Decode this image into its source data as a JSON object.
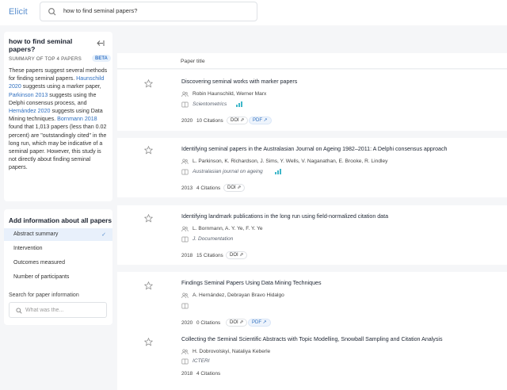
{
  "app": {
    "logo": "Elicit"
  },
  "search": {
    "query": "how to find seminal papers?"
  },
  "summary": {
    "question": "how to find seminal papers?",
    "label": "SUMMARY OF TOP 4 PAPERS",
    "badge": "BETA",
    "t1": "These papers suggest several methods for finding seminal papers. ",
    "l1": "Haunschild 2020",
    "t2": " suggests using a marker paper, ",
    "l2": "Parkinson 2013",
    "t3": " suggests using the Delphi consensus process, and ",
    "l3": "Hernández 2020",
    "t4": " suggests using Data Mining techniques. ",
    "l4": "Bornmann 2018",
    "t5": " found that 1,013 papers (less than 0.02 percent) are \"outstandingly cited\" in the long run, which may be indicative of a seminal paper. However, this study is not directly about finding seminal papers."
  },
  "add_info": {
    "title": "Add information about all papers",
    "items": [
      "Abstract summary",
      "Intervention",
      "Outcomes measured",
      "Number of participants"
    ],
    "selected_check": "✓",
    "search_label": "Search for paper information",
    "search_placeholder": "What was the..."
  },
  "table": {
    "column_header": "Paper title",
    "papers": [
      {
        "title": "Discovering seminal works with marker papers",
        "authors": "Robin Haunschild, Werner Marx",
        "venue": "Scientometrics",
        "year": "2020",
        "citations": "10 Citations",
        "doi": "DOI ⇗",
        "pdf": "PDF ↗"
      },
      {
        "title": "Identifying seminal papers in the Australasian Journal on Ageing 1982–2011: A Delphi consensus approach",
        "authors": "L. Parkinson, K. Richardson, J. Sims, Y. Wells, V. Naganathan, E. Brooke, R. Lindley",
        "venue": "Australasian journal on ageing",
        "year": "2013",
        "citations": "4 Citations",
        "doi": "DOI ⇗"
      },
      {
        "title": "Identifying landmark publications in the long run using field-normalized citation data",
        "authors": "L. Bornmann, A. Y. Ye, F. Y. Ye",
        "venue": "J. Documentation",
        "year": "2018",
        "citations": "15 Citations",
        "doi": "DOI ⇗"
      },
      {
        "title": "Findings Seminal Papers Using Data Mining Techniques",
        "authors": "A. Hernández, Debrayan Bravo Hidalgo",
        "year": "2020",
        "citations": "0 Citations",
        "doi": "DOI ⇗",
        "pdf": "PDF ↗"
      },
      {
        "title": "Collecting the Seminal Scientific Abstracts with Topic Modelling, Snowball Sampling and Citation Analysis",
        "authors": "H. Dobrovolskyi, Nataliya Keberle",
        "venue": "ICTERI",
        "year": "2018",
        "citations": "4 Citations"
      }
    ]
  },
  "colors": {
    "accent": "#5a8fcf",
    "link": "#2f6fbf",
    "bars": "#3fb7c9"
  }
}
